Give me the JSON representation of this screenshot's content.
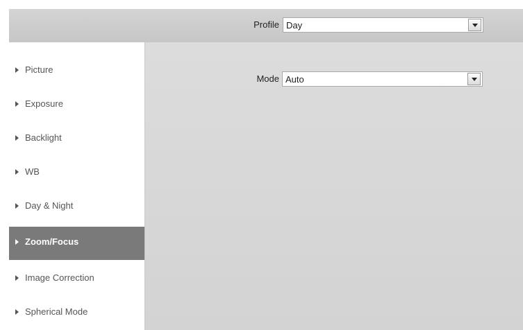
{
  "header": {
    "profile_label": "Profile",
    "profile_value": "Day"
  },
  "sidebar": {
    "items": [
      {
        "label": "Picture"
      },
      {
        "label": "Exposure"
      },
      {
        "label": "Backlight"
      },
      {
        "label": "WB"
      },
      {
        "label": "Day & Night"
      },
      {
        "label": "Zoom/Focus"
      },
      {
        "label": "Image Correction"
      },
      {
        "label": "Spherical Mode"
      }
    ],
    "active_index": 5
  },
  "main": {
    "mode_label": "Mode",
    "mode_value": "Auto"
  },
  "colors": {
    "active_item_bg": "#7a7a7a",
    "panel_bg": "#d6d6d6",
    "header_bg": "#cccccc"
  }
}
